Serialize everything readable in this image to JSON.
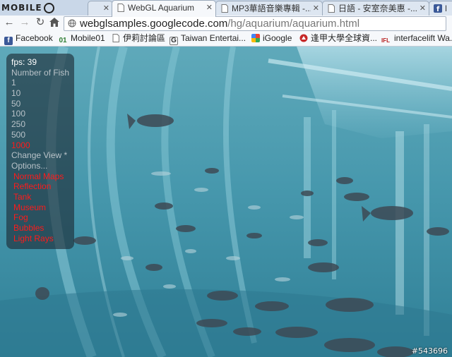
{
  "browser": {
    "logo": "MOBILE",
    "tabs": [
      {
        "title": "",
        "active": false
      },
      {
        "title": "WebGL Aquarium",
        "active": true
      },
      {
        "title": "MP3華語音樂專輯 -...",
        "active": false
      },
      {
        "title": "日語 - 安室奈美惠 -...",
        "active": false
      },
      {
        "title": "Fa",
        "active": false
      }
    ],
    "url_domain": "webglsamples.googlecode.com",
    "url_path": "/hg/aquarium/aquarium.html",
    "bookmarks": [
      {
        "label": "Facebook",
        "icon": "facebook-icon",
        "color": "#3b5998",
        "glyph": "f"
      },
      {
        "label": "Mobile01",
        "icon": "mobile01-icon",
        "color": "#2e7d32",
        "glyph": "01"
      },
      {
        "label": "伊莉討論區",
        "icon": "page-icon",
        "color": "#ffffff",
        "glyph": ""
      },
      {
        "label": "Taiwan Entertai...",
        "icon": "g-icon",
        "color": "#ffffff",
        "glyph": "G"
      },
      {
        "label": "iGoogle",
        "icon": "igoogle-icon",
        "color": "#ffffff",
        "glyph": ""
      },
      {
        "label": "逢甲大學全球資...",
        "icon": "fcu-icon",
        "color": "#c62828",
        "glyph": ""
      },
      {
        "label": "interfacelift Wa...",
        "icon": "ifl-icon",
        "color": "#b71c1c",
        "glyph": "IFL"
      }
    ]
  },
  "aquarium": {
    "fps_label": "fps: 39",
    "number_of_fish_label": "Number of Fish",
    "fish_counts": [
      "1",
      "10",
      "50",
      "100",
      "250",
      "500",
      "1000"
    ],
    "selected_count": "1000",
    "change_view_label": "Change View *",
    "options_label": "Options...",
    "options": [
      "Normal Maps",
      "Reflection",
      "Tank",
      "Museum",
      "Fog",
      "Bubbles",
      "Light Rays"
    ]
  },
  "watermark": "#543696",
  "colors": {
    "water": "#3d8fa3",
    "active_red": "#ff1a1a",
    "panel": "rgba(28,40,50,0.62)"
  }
}
